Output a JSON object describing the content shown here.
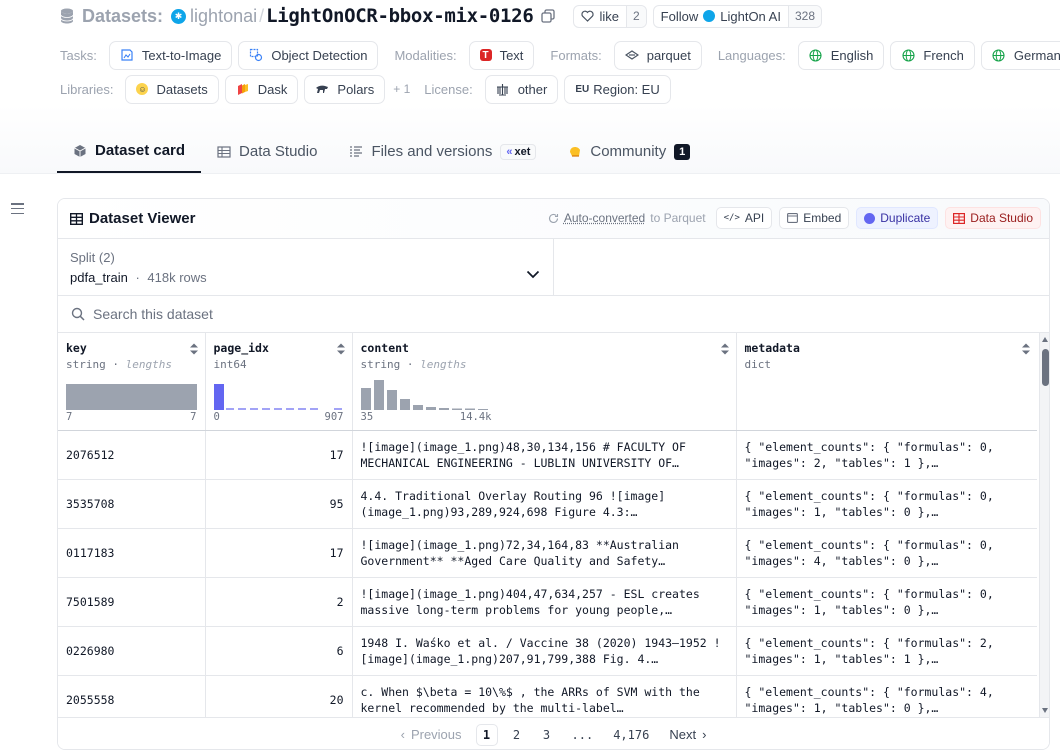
{
  "header": {
    "datasets_label": "Datasets:",
    "org": "lightonai",
    "separator": "/",
    "repo": "LightOnOCR-bbox-mix-0126",
    "like_label": "like",
    "like_count": "2",
    "follow_label": "Follow",
    "follow_org": "LightOn AI",
    "follow_count": "328"
  },
  "tags": {
    "tasks_label": "Tasks:",
    "tasks": [
      "Text-to-Image",
      "Object Detection"
    ],
    "modalities_label": "Modalities:",
    "modality": "Text",
    "formats_label": "Formats:",
    "format": "parquet",
    "languages_label": "Languages:",
    "languages": [
      "English",
      "French",
      "German"
    ],
    "libraries_label": "Libraries:",
    "libraries": [
      "Datasets",
      "Dask",
      "Polars"
    ],
    "libraries_more": "+ 1",
    "license_label": "License:",
    "license": "other",
    "region_prefix": "EU",
    "region": "Region: EU"
  },
  "tabs": [
    {
      "label": "Dataset card",
      "icon": "cube-icon"
    },
    {
      "label": "Data Studio",
      "icon": "table-icon"
    },
    {
      "label": "Files and versions",
      "icon": "files-icon",
      "badge": "xet"
    },
    {
      "label": "Community",
      "icon": "community-icon",
      "count": "1"
    }
  ],
  "viewer": {
    "title": "Dataset Viewer",
    "auto_converted": "Auto-converted",
    "to_parquet": "to Parquet",
    "api_label": "API",
    "embed_label": "Embed",
    "duplicate_label": "Duplicate",
    "studio_label": "Data Studio",
    "split_label": "Split (2)",
    "split_value": "pdfa_train",
    "split_dot": "·",
    "split_rows": "418k rows",
    "search_placeholder": "Search this dataset"
  },
  "columns": [
    {
      "name": "key",
      "type": "string",
      "type_extra": "lengths",
      "range_min": "7",
      "range_max": "7"
    },
    {
      "name": "page_idx",
      "type": "int64",
      "type_extra": "",
      "range_min": "0",
      "range_max": "907"
    },
    {
      "name": "content",
      "type": "string",
      "type_extra": "lengths",
      "range_min": "35",
      "range_max": "14.4k"
    },
    {
      "name": "metadata",
      "type": "dict",
      "type_extra": "",
      "range_min": "",
      "range_max": ""
    }
  ],
  "rows": [
    {
      "key": "2076512",
      "page_idx": "17",
      "content": "![image](image_1.png)48,30,134,156 # FACULTY OF MECHANICAL ENGINEERING - LUBLIN UNIVERSITY OF…",
      "metadata": "{ \"element_counts\": { \"formulas\": 0, \"images\": 2, \"tables\": 1 },…"
    },
    {
      "key": "3535708",
      "page_idx": "95",
      "content": "4.4. Traditional Overlay Routing 96 ![image](image_1.png)93,289,924,698 Figure 4.3:…",
      "metadata": "{ \"element_counts\": { \"formulas\": 0, \"images\": 1, \"tables\": 0 },…"
    },
    {
      "key": "0117183",
      "page_idx": "17",
      "content": "![image](image_1.png)72,34,164,83 **Australian Government** **Aged Care Quality and Safety…",
      "metadata": "{ \"element_counts\": { \"formulas\": 0, \"images\": 4, \"tables\": 0 },…"
    },
    {
      "key": "7501589",
      "page_idx": "2",
      "content": "![image](image_1.png)404,47,634,257 - ESL creates massive long-term problems for young people,…",
      "metadata": "{ \"element_counts\": { \"formulas\": 0, \"images\": 1, \"tables\": 0 },…"
    },
    {
      "key": "0226980",
      "page_idx": "6",
      "content": "1948 I. Waśko et al. / Vaccine 38 (2020) 1943–1952 ![image](image_1.png)207,91,799,388 Fig. 4.…",
      "metadata": "{ \"element_counts\": { \"formulas\": 2, \"images\": 1, \"tables\": 1 },…"
    },
    {
      "key": "2055558",
      "page_idx": "20",
      "content": "c. When $\\beta = 10\\%$ , the ARRs of SVM with the kernel recommended by the multi-label…",
      "metadata": "{ \"element_counts\": { \"formulas\": 4, \"images\": 1, \"tables\": 0 },…"
    },
    {
      "key": "",
      "page_idx": "",
      "content": "",
      "metadata": ""
    }
  ],
  "pagination": {
    "previous": "Previous",
    "pages": [
      "1",
      "2",
      "3"
    ],
    "ellipsis": "...",
    "last_page": "4,176",
    "next": "Next",
    "current": "1"
  },
  "colors": {
    "accent": "#6366f1",
    "hist_bar": "#9ca3af",
    "org_logo": "#0ea5e9"
  }
}
